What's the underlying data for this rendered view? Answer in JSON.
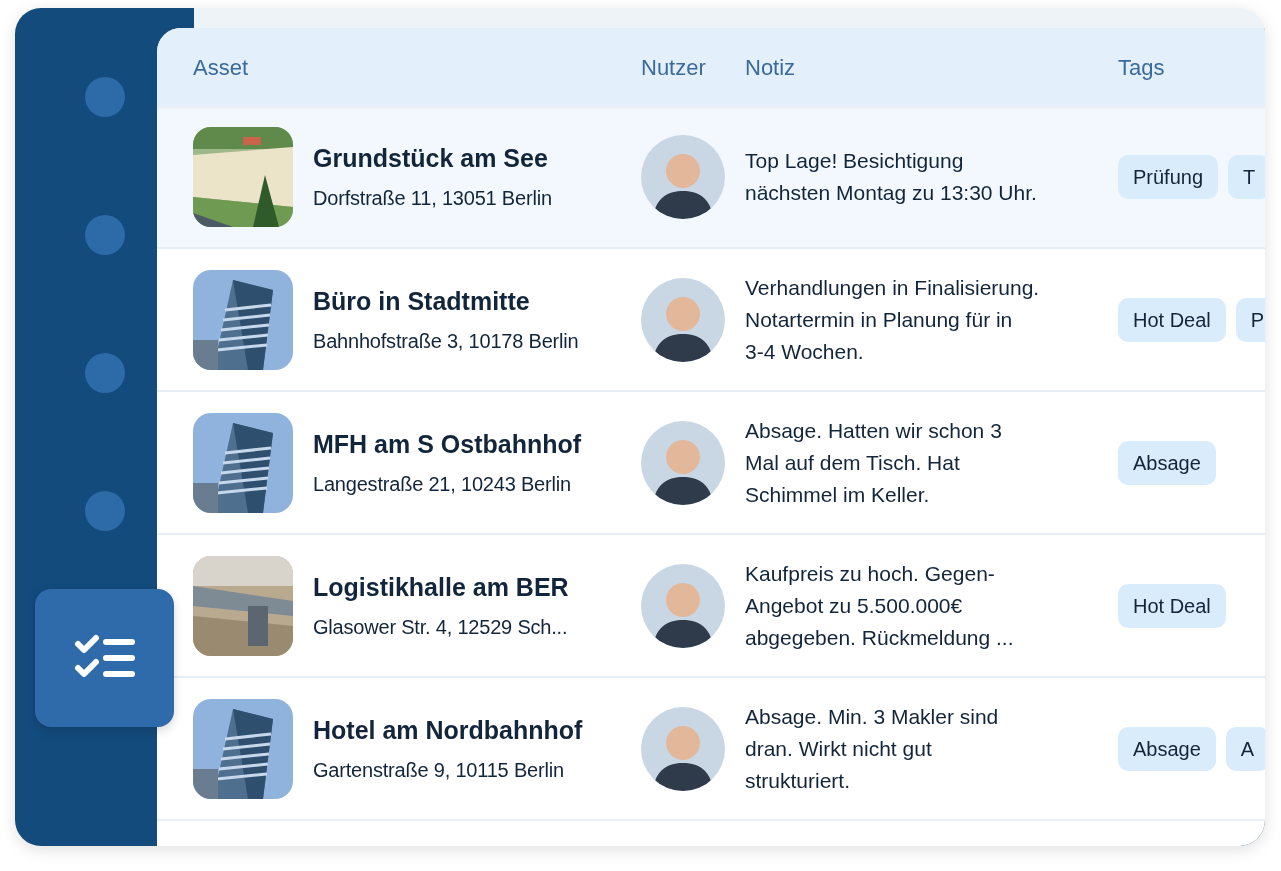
{
  "sidebar": {
    "items": [
      {
        "selected": false
      },
      {
        "selected": false
      },
      {
        "selected": false
      },
      {
        "selected": false
      },
      {
        "selected": true
      }
    ]
  },
  "table": {
    "columns": [
      "Asset",
      "Nutzer",
      "Notiz",
      "Tags"
    ],
    "rows": [
      {
        "selected": true,
        "name": "Grundstück am See",
        "address": "Dorfstraße 11, 13051 Berlin",
        "note": [
          "Top Lage! Besichtigung",
          "nächsten Montag zu 13:30 Uhr."
        ],
        "tags": [
          "Prüfung",
          "T"
        ]
      },
      {
        "selected": false,
        "name": "Büro in Stadtmitte",
        "address": "Bahnhofstraße 3, 10178 Berlin",
        "note": [
          "Verhandlungen in Finalisierung.",
          "Notartermin in Planung für in",
          "3-4 Wochen."
        ],
        "tags": [
          "Hot Deal",
          "P"
        ]
      },
      {
        "selected": false,
        "name": "MFH am S Ostbahnhof",
        "address": "Langestraße 21, 10243 Berlin",
        "note": [
          "Absage. Hatten wir schon 3",
          "Mal auf dem Tisch. Hat",
          "Schimmel im Keller."
        ],
        "tags": [
          "Absage"
        ]
      },
      {
        "selected": false,
        "name": "Logistikhalle am BER",
        "address": "Glasower Str. 4, 12529 Sch...",
        "note": [
          "Kaufpreis zu hoch. Gegen-",
          "Angebot zu 5.500.000€",
          "abgegeben. Rückmeldung ..."
        ],
        "tags": [
          "Hot Deal"
        ]
      },
      {
        "selected": false,
        "name": "Hotel am Nordbahnhof",
        "address": "Gartenstraße 9, 10115 Berlin",
        "note": [
          "Absage. Min. 3 Makler sind",
          "dran. Wirkt nicht gut",
          "strukturiert."
        ],
        "tags": [
          "Absage",
          "A"
        ]
      }
    ]
  }
}
